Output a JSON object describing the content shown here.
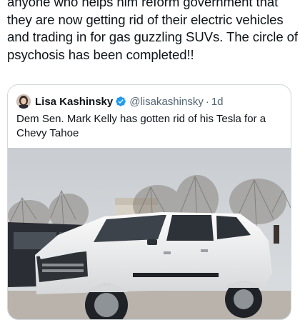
{
  "post": {
    "lines": [
      "anyone who helps him reform government that",
      "they are now getting rid of their electric vehicles",
      "and trading in for gas guzzling SUVs. The circle of",
      "psychosis has been completed!!"
    ]
  },
  "quote": {
    "name": "Lisa Kashinsky",
    "handle": "@lisakashinsky",
    "separator": "·",
    "time": "1d",
    "text_lines": [
      "Dem Sen. Mark Kelly has gotten rid of his Tesla for a",
      "Chevy Tahoe"
    ],
    "verified_color": "#1d9bf0",
    "media": {
      "icon": "suv-photo"
    }
  }
}
